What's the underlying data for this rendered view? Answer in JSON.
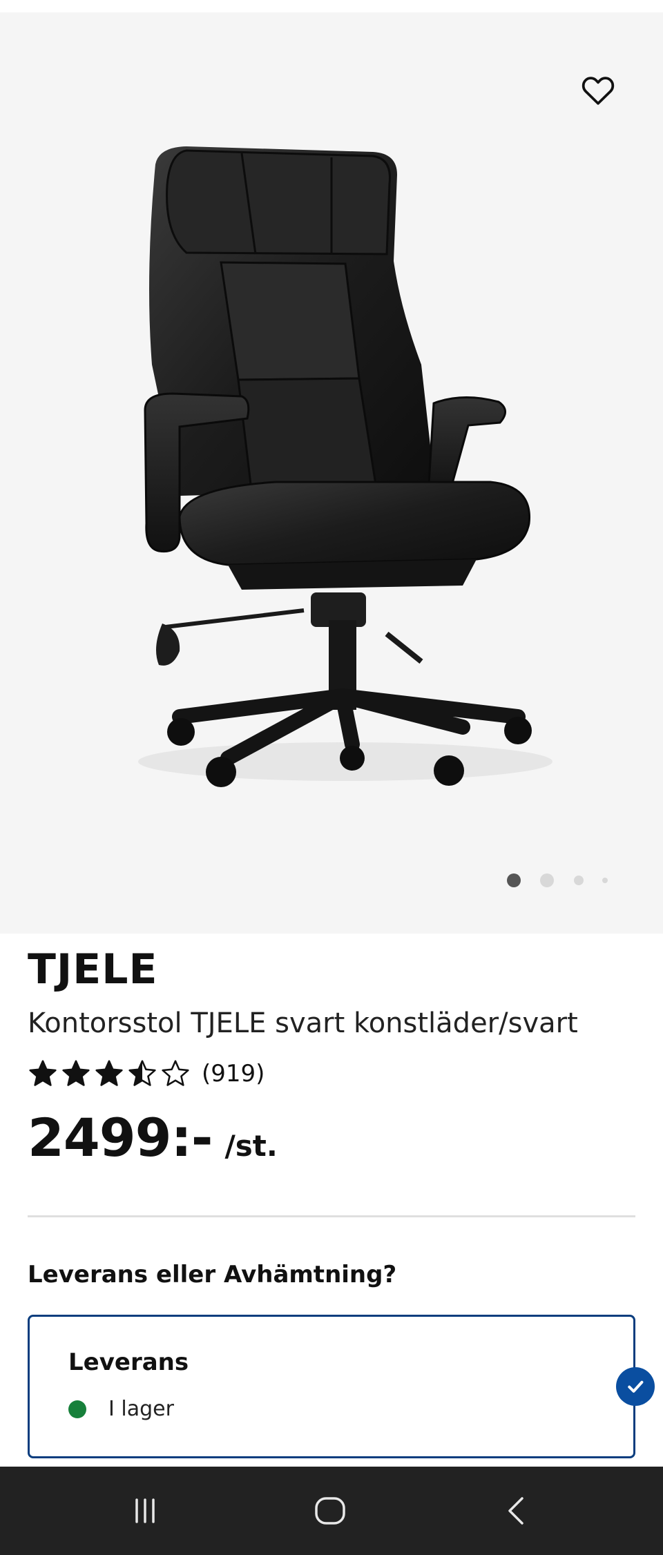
{
  "product": {
    "brand": "TJELE",
    "description": "Kontorsstol TJELE svart konstläder/svart",
    "rating_value": 3.5,
    "rating_max": 5,
    "rating_count": "(919)",
    "price": "2499:-",
    "price_unit": "/st."
  },
  "gallery": {
    "image_count": 4,
    "active_index": 0
  },
  "delivery": {
    "section_title": "Leverans eller Avhämtning?",
    "option_title": "Leverans",
    "status_text": "I lager",
    "selected": true
  },
  "icons": {
    "favorite": "heart-outline-icon",
    "selected": "checkmark-icon",
    "nav_recents": "recent-apps-icon",
    "nav_home": "home-icon",
    "nav_back": "back-icon"
  },
  "colors": {
    "accent": "#0a3d7e",
    "check": "#0a4ea0",
    "in_stock": "#17803b",
    "gallery_bg": "#f5f5f5",
    "navbar_bg": "#222222"
  }
}
